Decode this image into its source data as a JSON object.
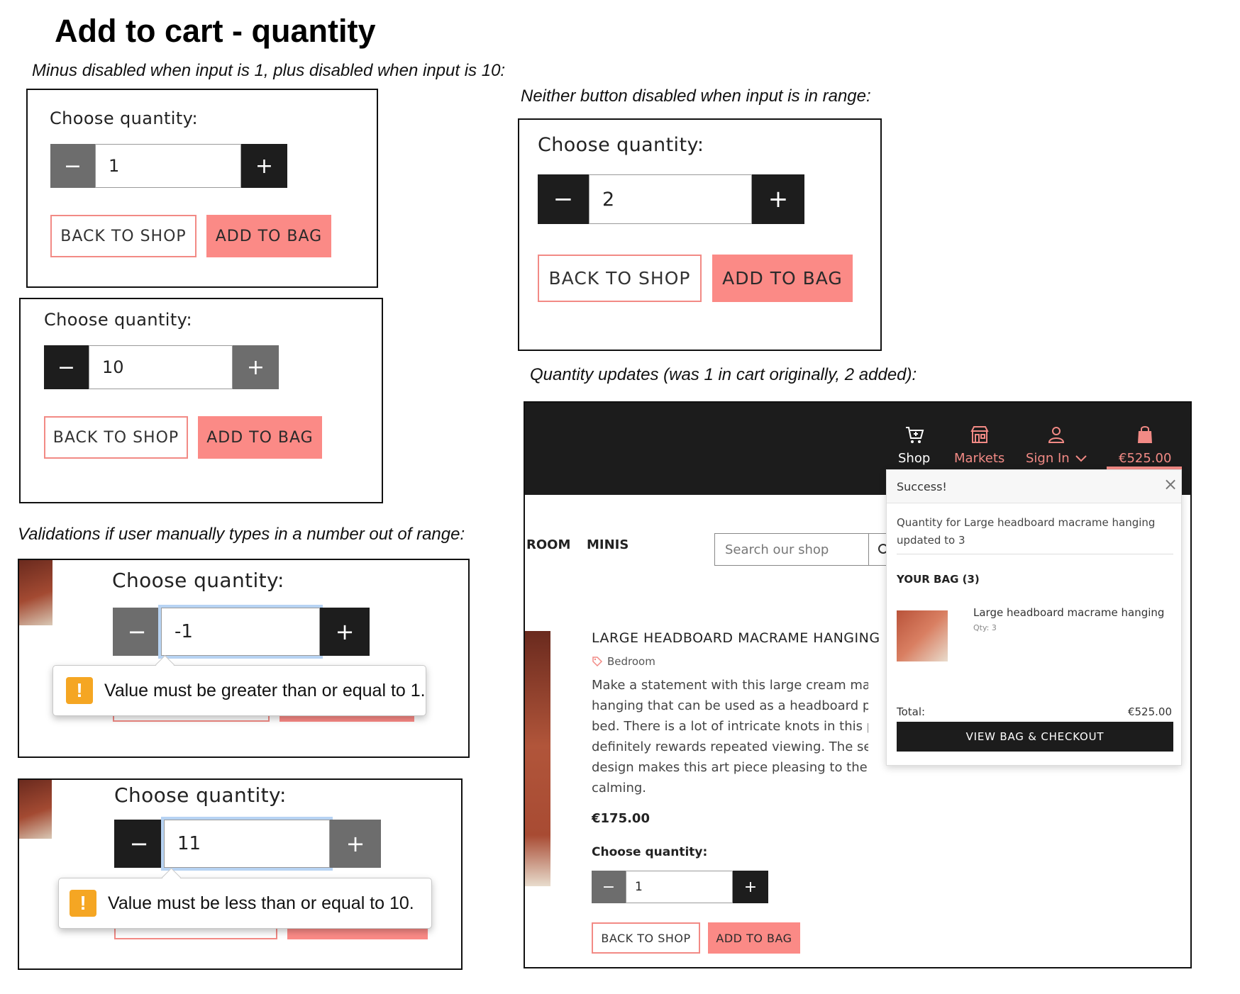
{
  "page_title": "Add to cart - quantity",
  "captions": {
    "limits": "Minus disabled when input is 1, plus disabled when input is 10:",
    "in_range": "Neither button disabled when input is in range:",
    "validations": "Validations if user manually types in a number out of range:",
    "cart_update": "Quantity updates (was 1 in cart originally, 2 added):"
  },
  "common": {
    "choose_quantity": "Choose quantity:",
    "back_to_shop": "BACK TO SHOP",
    "add_to_bag": "ADD TO BAG",
    "minus_symbol": "−",
    "plus_symbol": "+"
  },
  "example_min": {
    "value": "1",
    "minus_disabled": true,
    "plus_disabled": false
  },
  "example_max": {
    "value": "10",
    "minus_disabled": false,
    "plus_disabled": true
  },
  "example_range": {
    "value": "2",
    "minus_disabled": false,
    "plus_disabled": false
  },
  "validation_low": {
    "value": "-1",
    "message": "Value must be greater than or equal to 1.",
    "warn_icon": "!"
  },
  "validation_high": {
    "value": "11",
    "message": "Value must be less than or equal to 10.",
    "warn_icon": "!"
  },
  "store": {
    "nav": [
      {
        "label": "Shop",
        "icon": "cart-icon",
        "color": "#ffffff"
      },
      {
        "label": "Markets",
        "icon": "store-icon",
        "color": "#f28a85"
      },
      {
        "label": "Sign In",
        "icon": "user-icon",
        "color": "#f28a85"
      },
      {
        "label": "€525.00",
        "icon": "bag-icon",
        "color": "#f28a85"
      }
    ],
    "categories": [
      "ROOM",
      "MINIS"
    ],
    "search_placeholder": "Search our shop",
    "product": {
      "name": "LARGE HEADBOARD MACRAME HANGING",
      "tag": "Bedroom",
      "description_lines": [
        "Make a statement with this large cream macrame",
        "hanging that can be used as a headboard piece b",
        "bed. There is a lot of intricate knots in this piece a",
        "definitely rewards repeated viewing. The semi-cir",
        "design makes this art piece pleasing to the eye ar",
        "calming."
      ],
      "price": "€175.00",
      "choose_quantity": "Choose quantity:",
      "quantity": "1",
      "back_to_shop": "BACK TO SHOP",
      "add_to_bag": "ADD TO BAG"
    },
    "popup": {
      "title": "Success!",
      "close_symbol": "×",
      "message_line1": "Quantity for Large headboard macrame hanging",
      "message_line2": "updated to 3",
      "bag_heading": "YOUR BAG (3)",
      "item_name": "Large headboard macrame hanging",
      "item_qty": "Qty: 3",
      "total_label": "Total:",
      "total_value": "€525.00",
      "checkout_label": "VIEW BAG & CHECKOUT"
    }
  },
  "colors": {
    "accent": "#fb8a86",
    "dark_button": "#1d1d1d",
    "disabled_button": "#6d6d6d",
    "warning": "#f5a623"
  }
}
